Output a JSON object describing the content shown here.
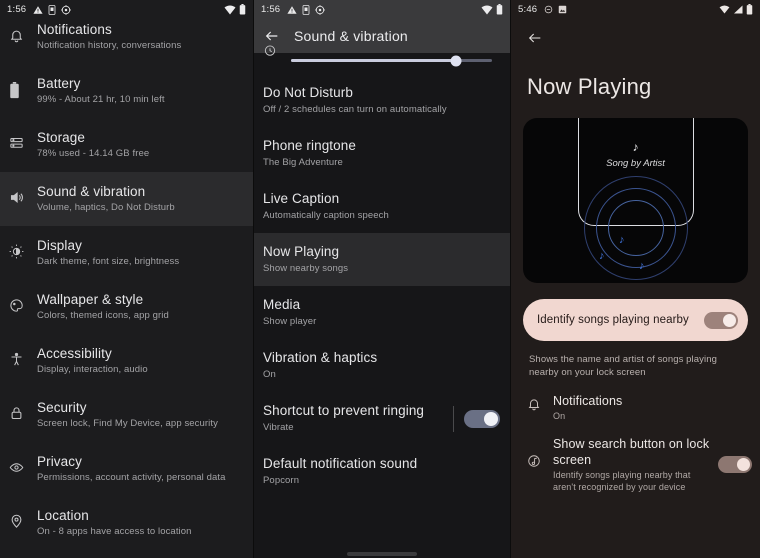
{
  "panel_settings": {
    "statusbar": {
      "clock": "1:56",
      "icons": [
        "warning-icon",
        "device-icon",
        "gear-icon"
      ],
      "right_icons": [
        "wifi-icon",
        "battery-icon"
      ]
    },
    "items": [
      {
        "icon": "bell-icon",
        "title": "Notifications",
        "sub": "Notification history, conversations",
        "selected": false
      },
      {
        "icon": "battery-icon",
        "title": "Battery",
        "sub": "99% - About 21 hr, 10 min left",
        "selected": false
      },
      {
        "icon": "storage-icon",
        "title": "Storage",
        "sub": "78% used - 14.14 GB free",
        "selected": false
      },
      {
        "icon": "volume-icon",
        "title": "Sound & vibration",
        "sub": "Volume, haptics, Do Not Disturb",
        "selected": true
      },
      {
        "icon": "brightness-icon",
        "title": "Display",
        "sub": "Dark theme, font size, brightness",
        "selected": false
      },
      {
        "icon": "palette-icon",
        "title": "Wallpaper & style",
        "sub": "Colors, themed icons, app grid",
        "selected": false
      },
      {
        "icon": "accessibility-icon",
        "title": "Accessibility",
        "sub": "Display, interaction, audio",
        "selected": false
      },
      {
        "icon": "lock-icon",
        "title": "Security",
        "sub": "Screen lock, Find My Device, app security",
        "selected": false
      },
      {
        "icon": "eye-icon",
        "title": "Privacy",
        "sub": "Permissions, account activity, personal data",
        "selected": false
      },
      {
        "icon": "location-pin-icon",
        "title": "Location",
        "sub": "On - 8 apps have access to location",
        "selected": false
      }
    ]
  },
  "panel_sound": {
    "statusbar": {
      "clock": "1:56",
      "icons": [
        "warning-icon",
        "device-icon",
        "gear-icon"
      ],
      "right_icons": [
        "wifi-icon",
        "battery-icon"
      ]
    },
    "appbar": {
      "back": "back-arrow-icon",
      "title": "Sound & vibration"
    },
    "slider": {
      "icon": "alarm-icon",
      "value": 82
    },
    "items": [
      {
        "title": "Do Not Disturb",
        "sub": "Off / 2 schedules can turn on automatically",
        "selected": false,
        "switch": null
      },
      {
        "title": "Phone ringtone",
        "sub": "The Big Adventure",
        "selected": false,
        "switch": null
      },
      {
        "title": "Live Caption",
        "sub": "Automatically caption speech",
        "selected": false,
        "switch": null
      },
      {
        "title": "Now Playing",
        "sub": "Show nearby songs",
        "selected": true,
        "switch": null
      },
      {
        "title": "Media",
        "sub": "Show player",
        "selected": false,
        "switch": null
      },
      {
        "title": "Vibration & haptics",
        "sub": "On",
        "selected": false,
        "switch": null
      },
      {
        "title": "Shortcut to prevent ringing",
        "sub": "Vibrate",
        "selected": false,
        "switch": "on"
      },
      {
        "title": "Default notification sound",
        "sub": "Popcorn",
        "selected": false,
        "switch": null
      }
    ]
  },
  "panel_now_playing": {
    "statusbar": {
      "clock": "5:46",
      "icons": [
        "dnd-icon",
        "image-icon"
      ],
      "right_icons": [
        "wifi-icon",
        "signal-icon",
        "battery-icon"
      ]
    },
    "back": "back-arrow-icon",
    "title": "Now Playing",
    "hero": {
      "note_icon": "music-note-icon",
      "caption": "Song by Artist"
    },
    "pill": {
      "label": "Identify songs playing nearby",
      "switch": "on"
    },
    "description": "Shows the name and artist of songs playing nearby on your lock screen",
    "items": [
      {
        "icon": "bell-icon",
        "title": "Notifications",
        "sub": "On",
        "switch": null
      },
      {
        "icon": "music-search-icon",
        "title": "Show search button on lock screen",
        "sub": "Identify songs playing nearby that aren't recognized by your device",
        "switch": "on"
      }
    ]
  },
  "colors": {
    "panel_bg_neutral": "#1c1c1e",
    "panel_bg_warm": "#211c1b",
    "appbar_bg": "#3a3a3c",
    "selected_row": "#2b2b2d",
    "pill_bg": "#f1d7d0",
    "accent_blue": "#3f72d8",
    "switch_on_blue": "#6a7085",
    "switch_on_warm": "#9d827b"
  }
}
